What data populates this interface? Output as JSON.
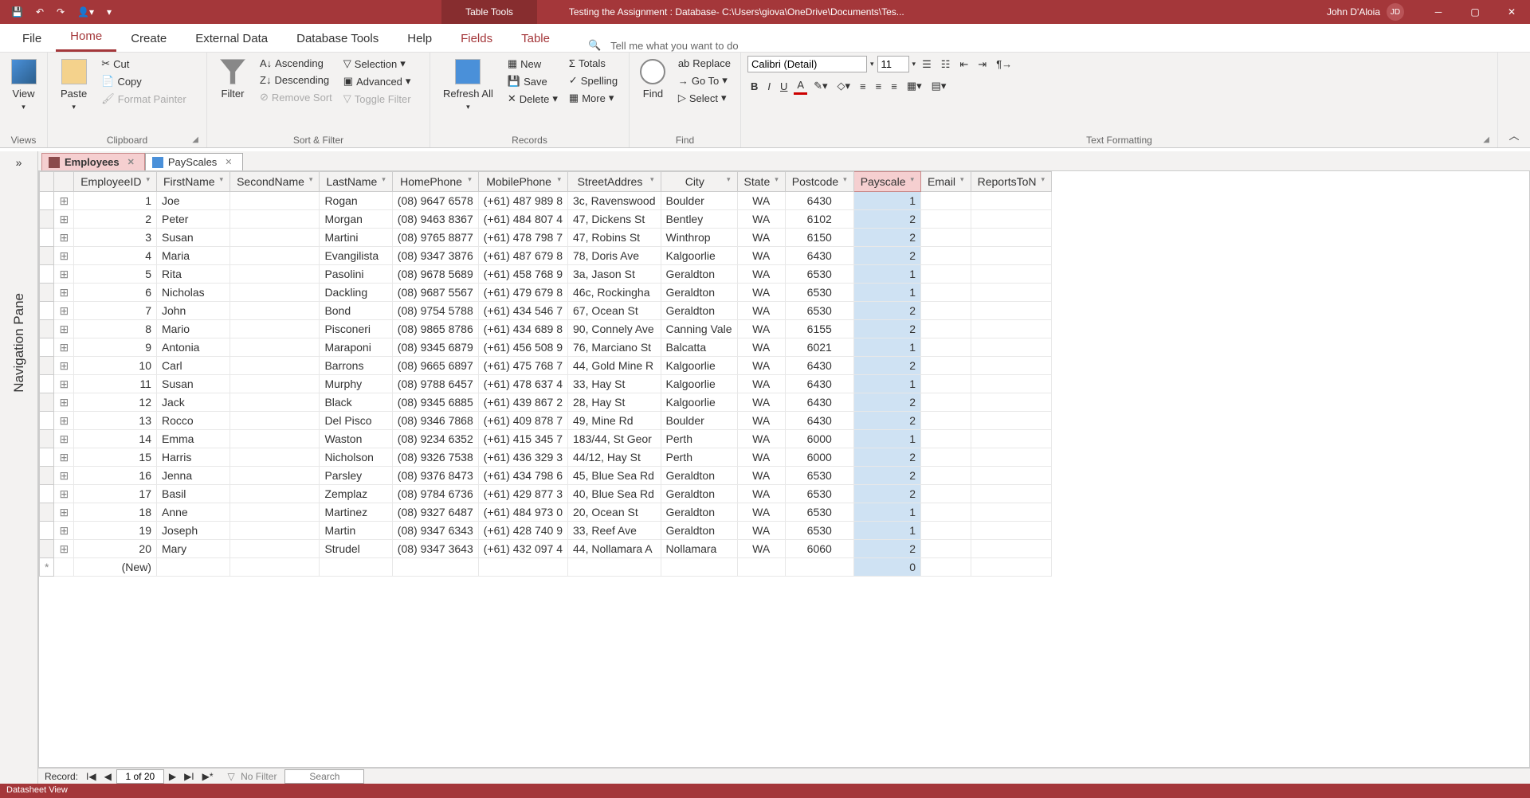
{
  "titlebar": {
    "contextual_label": "Table Tools",
    "app_title": "Testing the Assignment : Database- C:\\Users\\giova\\OneDrive\\Documents\\Tes...",
    "user_name": "John D'Aloia",
    "user_initials": "JD"
  },
  "tabs": {
    "file": "File",
    "home": "Home",
    "create": "Create",
    "external": "External Data",
    "dbtools": "Database Tools",
    "help": "Help",
    "fields": "Fields",
    "table": "Table",
    "tellme_placeholder": "Tell me what you want to do"
  },
  "ribbon": {
    "view": "View",
    "paste": "Paste",
    "cut": "Cut",
    "copy": "Copy",
    "format_painter": "Format Painter",
    "clipboard": "Clipboard",
    "filter": "Filter",
    "ascending": "Ascending",
    "descending": "Descending",
    "remove_sort": "Remove Sort",
    "selection": "Selection",
    "advanced": "Advanced",
    "toggle_filter": "Toggle Filter",
    "sort_filter": "Sort & Filter",
    "refresh": "Refresh All",
    "new": "New",
    "save": "Save",
    "delete": "Delete",
    "totals": "Totals",
    "spelling": "Spelling",
    "more": "More",
    "records": "Records",
    "find": "Find",
    "replace": "Replace",
    "goto": "Go To",
    "select": "Select",
    "find_group": "Find",
    "font_name": "Calibri (Detail)",
    "font_size": "11",
    "text_formatting": "Text Formatting",
    "views": "Views"
  },
  "nav": {
    "toggle": "»",
    "label": "Navigation Pane"
  },
  "doctabs": {
    "employees": "Employees",
    "payscales": "PayScales"
  },
  "columns": [
    "EmployeeID",
    "FirstName",
    "SecondName",
    "LastName",
    "HomePhone",
    "MobilePhone",
    "StreetAddres",
    "City",
    "State",
    "Postcode",
    "Payscale",
    "Email",
    "ReportsToN"
  ],
  "rows": [
    {
      "id": 1,
      "first": "Joe",
      "last": "Rogan",
      "home": "(08) 9647 6578",
      "mob": "(+61) 487 989 8",
      "addr": "3c, Ravenswood",
      "city": "Boulder",
      "state": "WA",
      "post": "6430",
      "pay": 1
    },
    {
      "id": 2,
      "first": "Peter",
      "last": "Morgan",
      "home": "(08) 9463 8367",
      "mob": "(+61) 484 807 4",
      "addr": "47, Dickens St",
      "city": "Bentley",
      "state": "WA",
      "post": "6102",
      "pay": 2
    },
    {
      "id": 3,
      "first": "Susan",
      "last": "Martini",
      "home": "(08) 9765 8877",
      "mob": "(+61) 478 798 7",
      "addr": "47, Robins St",
      "city": "Winthrop",
      "state": "WA",
      "post": "6150",
      "pay": 2
    },
    {
      "id": 4,
      "first": "Maria",
      "last": "Evangilista",
      "home": "(08) 9347 3876",
      "mob": "(+61) 487 679 8",
      "addr": "78, Doris Ave",
      "city": "Kalgoorlie",
      "state": "WA",
      "post": "6430",
      "pay": 2
    },
    {
      "id": 5,
      "first": "Rita",
      "last": "Pasolini",
      "home": "(08) 9678 5689",
      "mob": "(+61) 458 768 9",
      "addr": "3a, Jason St",
      "city": "Geraldton",
      "state": "WA",
      "post": "6530",
      "pay": 1
    },
    {
      "id": 6,
      "first": "Nicholas",
      "last": "Dackling",
      "home": "(08) 9687 5567",
      "mob": "(+61) 479 679 8",
      "addr": "46c, Rockingha",
      "city": "Geraldton",
      "state": "WA",
      "post": "6530",
      "pay": 1
    },
    {
      "id": 7,
      "first": "John",
      "last": "Bond",
      "home": "(08) 9754 5788",
      "mob": "(+61) 434 546 7",
      "addr": "67, Ocean St",
      "city": "Geraldton",
      "state": "WA",
      "post": "6530",
      "pay": 2
    },
    {
      "id": 8,
      "first": "Mario",
      "last": "Pisconeri",
      "home": "(08) 9865 8786",
      "mob": "(+61) 434 689 8",
      "addr": "90, Connely Ave",
      "city": "Canning Vale",
      "state": "WA",
      "post": "6155",
      "pay": 2
    },
    {
      "id": 9,
      "first": "Antonia",
      "last": "Maraponi",
      "home": "(08) 9345 6879",
      "mob": "(+61) 456 508 9",
      "addr": "76, Marciano St",
      "city": "Balcatta",
      "state": "WA",
      "post": "6021",
      "pay": 1
    },
    {
      "id": 10,
      "first": "Carl",
      "last": "Barrons",
      "home": "(08) 9665 6897",
      "mob": "(+61) 475 768 7",
      "addr": "44, Gold Mine R",
      "city": "Kalgoorlie",
      "state": "WA",
      "post": "6430",
      "pay": 2
    },
    {
      "id": 11,
      "first": "Susan",
      "last": "Murphy",
      "home": "(08) 9788 6457",
      "mob": "(+61) 478 637 4",
      "addr": "33, Hay St",
      "city": "Kalgoorlie",
      "state": "WA",
      "post": "6430",
      "pay": 1
    },
    {
      "id": 12,
      "first": "Jack",
      "last": "Black",
      "home": "(08) 9345 6885",
      "mob": "(+61) 439 867 2",
      "addr": "28, Hay St",
      "city": "Kalgoorlie",
      "state": "WA",
      "post": "6430",
      "pay": 2
    },
    {
      "id": 13,
      "first": "Rocco",
      "last": "Del Pisco",
      "home": "(08) 9346 7868",
      "mob": "(+61) 409 878 7",
      "addr": "49, Mine Rd",
      "city": "Boulder",
      "state": "WA",
      "post": "6430",
      "pay": 2
    },
    {
      "id": 14,
      "first": "Emma",
      "last": "Waston",
      "home": "(08) 9234 6352",
      "mob": "(+61) 415 345 7",
      "addr": "183/44, St Geor",
      "city": "Perth",
      "state": "WA",
      "post": "6000",
      "pay": 1
    },
    {
      "id": 15,
      "first": "Harris",
      "last": "Nicholson",
      "home": "(08) 9326 7538",
      "mob": "(+61) 436 329 3",
      "addr": "44/12, Hay St",
      "city": "Perth",
      "state": "WA",
      "post": "6000",
      "pay": 2
    },
    {
      "id": 16,
      "first": "Jenna",
      "last": "Parsley",
      "home": "(08) 9376 8473",
      "mob": "(+61) 434 798 6",
      "addr": "45, Blue Sea Rd",
      "city": "Geraldton",
      "state": "WA",
      "post": "6530",
      "pay": 2
    },
    {
      "id": 17,
      "first": "Basil",
      "last": "Zemplaz",
      "home": "(08) 9784 6736",
      "mob": "(+61) 429 877 3",
      "addr": "40, Blue Sea Rd",
      "city": "Geraldton",
      "state": "WA",
      "post": "6530",
      "pay": 2
    },
    {
      "id": 18,
      "first": "Anne",
      "last": "Martinez",
      "home": "(08) 9327 6487",
      "mob": "(+61) 484 973 0",
      "addr": "20, Ocean St",
      "city": "Geraldton",
      "state": "WA",
      "post": "6530",
      "pay": 1
    },
    {
      "id": 19,
      "first": "Joseph",
      "last": "Martin",
      "home": "(08) 9347 6343",
      "mob": "(+61) 428 740 9",
      "addr": "33, Reef Ave",
      "city": "Geraldton",
      "state": "WA",
      "post": "6530",
      "pay": 1
    },
    {
      "id": 20,
      "first": "Mary",
      "last": "Strudel",
      "home": "(08) 9347 3643",
      "mob": "(+61) 432 097 4",
      "addr": "44, Nollamara A",
      "city": "Nollamara",
      "state": "WA",
      "post": "6060",
      "pay": 2
    }
  ],
  "newrow_label": "(New)",
  "newrow_pay": 0,
  "recnav": {
    "label": "Record:",
    "pos": "1 of 20",
    "nofilter": "No Filter",
    "search_placeholder": "Search"
  },
  "status": "Datasheet View"
}
